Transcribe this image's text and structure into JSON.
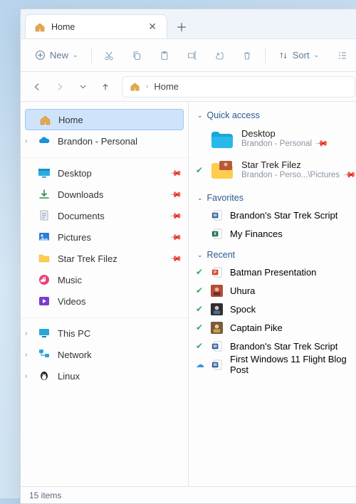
{
  "tab": {
    "title": "Home"
  },
  "toolbar": {
    "new": "New",
    "sort": "Sort"
  },
  "breadcrumb": {
    "current": "Home"
  },
  "sidebar": {
    "top": [
      {
        "label": "Home",
        "selected": true
      },
      {
        "label": "Brandon - Personal",
        "expandable": true
      }
    ],
    "quick": [
      {
        "label": "Desktop",
        "pin": true,
        "icon": "desktop"
      },
      {
        "label": "Downloads",
        "pin": true,
        "icon": "downloads"
      },
      {
        "label": "Documents",
        "pin": true,
        "icon": "documents"
      },
      {
        "label": "Pictures",
        "pin": true,
        "icon": "pictures"
      },
      {
        "label": "Star Trek Filez",
        "pin": true,
        "icon": "folder"
      },
      {
        "label": "Music",
        "pin": false,
        "icon": "music"
      },
      {
        "label": "Videos",
        "pin": false,
        "icon": "videos"
      }
    ],
    "locations": [
      {
        "label": "This PC",
        "expandable": true,
        "icon": "pc"
      },
      {
        "label": "Network",
        "expandable": true,
        "icon": "network"
      },
      {
        "label": "Linux",
        "expandable": true,
        "icon": "linux"
      }
    ]
  },
  "main": {
    "quick_header": "Quick access",
    "quick": [
      {
        "title": "Desktop",
        "sub": "Brandon - Personal",
        "thumb": "desktop-tile"
      },
      {
        "title": "Star Trek Filez",
        "sub": "Brandon - Perso...\\Pictures",
        "thumb": "folder-photo",
        "synced": true
      }
    ],
    "fav_header": "Favorites",
    "favorites": [
      {
        "title": "Brandon's Star Trek Script",
        "icon": "word"
      },
      {
        "title": "My Finances",
        "icon": "excel"
      }
    ],
    "recent_header": "Recent",
    "recent": [
      {
        "title": "Batman Presentation",
        "icon": "ppt",
        "synced": true
      },
      {
        "title": "Uhura",
        "icon": "photo1",
        "synced": true
      },
      {
        "title": "Spock",
        "icon": "photo2",
        "synced": true
      },
      {
        "title": "Captain Pike",
        "icon": "photo3",
        "synced": true
      },
      {
        "title": "Brandon's Star Trek Script",
        "icon": "word",
        "synced": true
      },
      {
        "title": "First Windows 11 Flight Blog Post",
        "icon": "word",
        "cloud": true
      }
    ]
  },
  "status": {
    "count": "15 items"
  },
  "colors": {
    "word": "#2b579a",
    "excel": "#217346",
    "ppt": "#d24726",
    "folder": "#ffcd4b",
    "desktop_tile": "#19a6d8",
    "cloud": "#3a95d6",
    "check": "#2fae5f"
  }
}
